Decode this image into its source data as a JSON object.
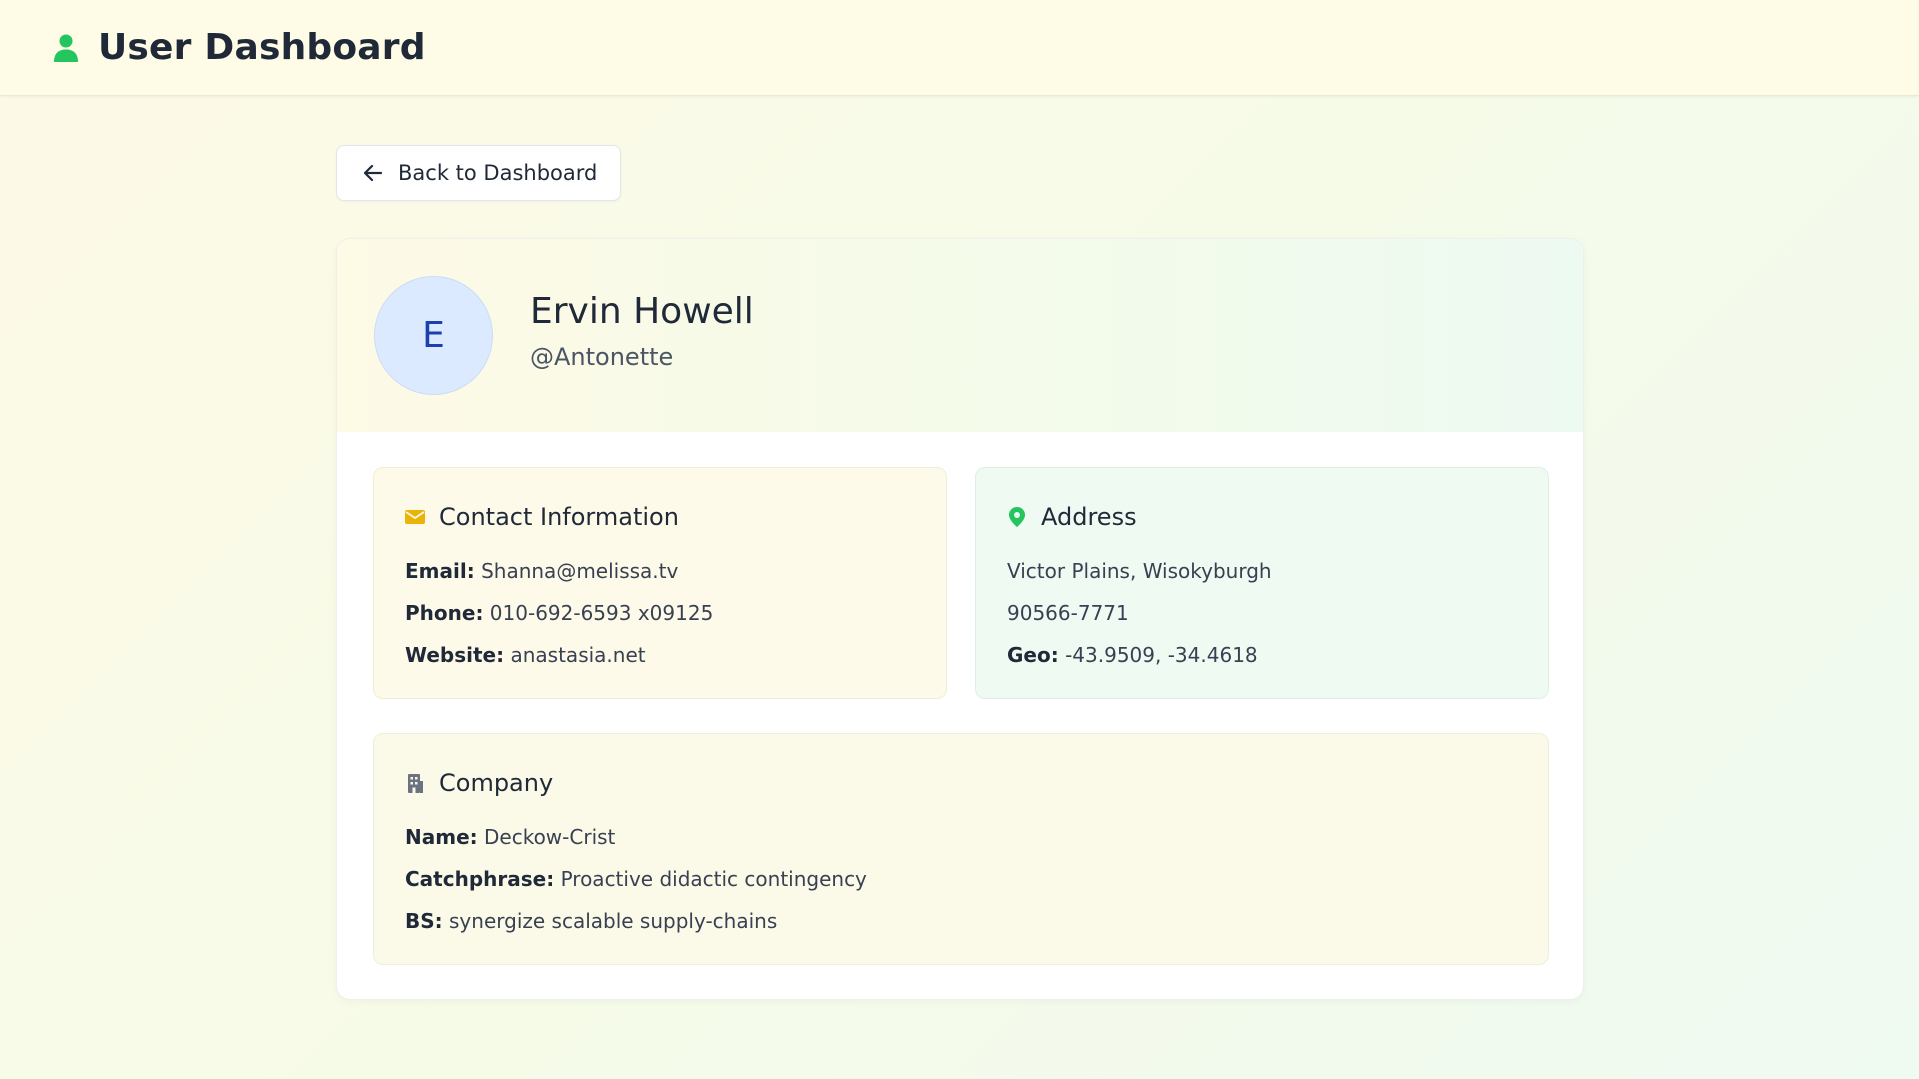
{
  "header": {
    "title": "User Dashboard",
    "icon": "user-icon",
    "icon_color": "#22c55e"
  },
  "back_button": {
    "label": "Back to Dashboard",
    "icon": "arrow-left-icon"
  },
  "profile": {
    "initial": "E",
    "name": "Ervin Howell",
    "username": "@Antonette"
  },
  "contact": {
    "title": "Contact Information",
    "icon": "mail-icon",
    "icon_color": "#eab308",
    "email_label": "Email:",
    "email": "Shanna@melissa.tv",
    "phone_label": "Phone:",
    "phone": "010-692-6593 x09125",
    "website_label": "Website:",
    "website": "anastasia.net"
  },
  "address": {
    "title": "Address",
    "icon": "map-pin-icon",
    "icon_color": "#22c55e",
    "street_city": "Victor Plains, Wisokyburgh",
    "zipcode": "90566-7771",
    "geo_label": "Geo:",
    "geo": "-43.9509, -34.4618"
  },
  "company": {
    "title": "Company",
    "icon": "building-icon",
    "icon_color": "#6b7280",
    "name_label": "Name:",
    "name": "Deckow-Crist",
    "catchphrase_label": "Catchphrase:",
    "catchphrase": "Proactive didactic contingency",
    "bs_label": "BS:",
    "bs": "synergize scalable supply-chains"
  }
}
